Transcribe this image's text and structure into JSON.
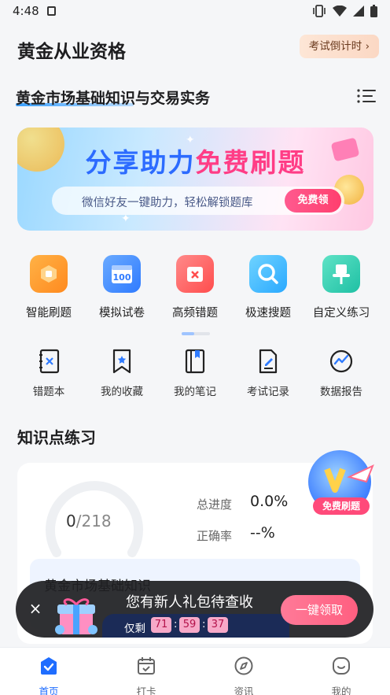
{
  "status_bar": {
    "time": "4:48"
  },
  "header": {
    "title": "黄金从业资格",
    "countdown_label": "考试倒计时",
    "countdown_chevron": "›"
  },
  "subject": {
    "title": "黄金市场基础知识与交易实务",
    "menu_icon": "list-icon"
  },
  "banner": {
    "title_part1": "分享助力",
    "title_part2": "免费刷题",
    "subtitle": "微信好友一键助力，轻松解锁题库",
    "cta": "免费领"
  },
  "features": [
    {
      "label": "智能刷题",
      "icon": "smart-practice-icon",
      "color": "#ff9a2e"
    },
    {
      "label": "模拟试卷",
      "icon": "mock-exam-icon",
      "color": "#3b8bff"
    },
    {
      "label": "高频错题",
      "icon": "frequent-errors-icon",
      "color": "#ff5a5a"
    },
    {
      "label": "极速搜题",
      "icon": "search-icon",
      "color": "#2fb7ff"
    },
    {
      "label": "自定义练习",
      "icon": "custom-practice-icon",
      "color": "#2ccfb3"
    }
  ],
  "tools": [
    {
      "label": "错题本",
      "icon": "error-book-icon"
    },
    {
      "label": "我的收藏",
      "icon": "bookmark-icon"
    },
    {
      "label": "我的笔记",
      "icon": "notes-icon"
    },
    {
      "label": "考试记录",
      "icon": "exam-record-icon"
    },
    {
      "label": "数据报告",
      "icon": "data-report-icon"
    }
  ],
  "knowledge": {
    "section_title": "知识点练习",
    "done": "0",
    "separator": "/",
    "total": "218",
    "progress_label": "总进度",
    "progress_value": "0.0%",
    "accuracy_label": "正确率",
    "accuracy_value": "--%",
    "item_title": "黄金市场基础知识"
  },
  "float_badge": {
    "label": "免费刷题"
  },
  "toast": {
    "title": "您有新人礼包待查收",
    "timer_label": "仅剩",
    "hours": "71",
    "minutes": "59",
    "seconds": "37",
    "colon": ":",
    "button": "一键领取",
    "close": "×"
  },
  "tabbar": [
    {
      "label": "首页",
      "icon": "home-icon",
      "active": true
    },
    {
      "label": "打卡",
      "icon": "calendar-icon",
      "active": false
    },
    {
      "label": "资讯",
      "icon": "compass-icon",
      "active": false
    },
    {
      "label": "我的",
      "icon": "profile-icon",
      "active": false
    }
  ],
  "colors": {
    "accent": "#1f6dff",
    "pink": "#ff3d86",
    "toast_bg": "#1e1e22"
  }
}
